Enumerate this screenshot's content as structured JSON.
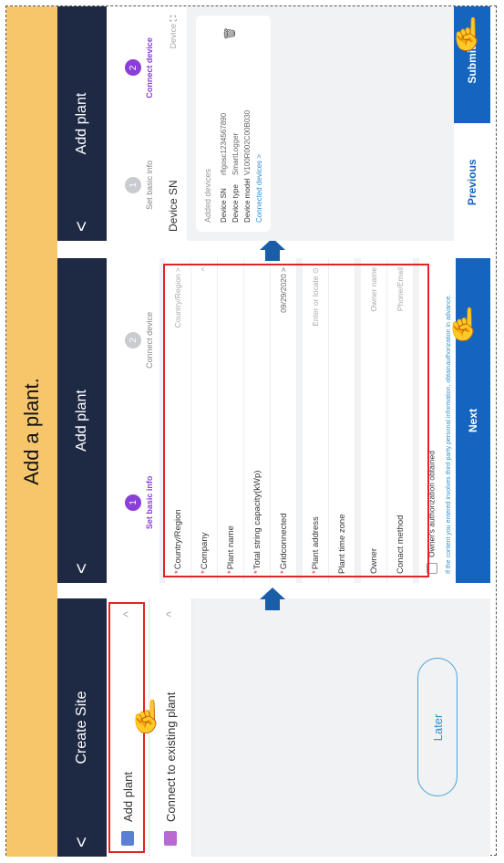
{
  "banner": "Add a plant.",
  "screen1": {
    "title": "Create Site",
    "back": "<",
    "items": [
      {
        "label": "Add plant",
        "chevron": "^"
      },
      {
        "label": "Connect to existing plant",
        "chevron": "^"
      }
    ],
    "later": "Later"
  },
  "screen2": {
    "title": "Add plant",
    "back": "<",
    "steps": [
      {
        "num": "1",
        "label": "Set basic info"
      },
      {
        "num": "2",
        "label": "Connect device"
      }
    ],
    "fields": [
      {
        "label": "Country/Region",
        "required": "*",
        "value": "Country/Region >"
      },
      {
        "label": "Company",
        "required": "*",
        "value": "^"
      },
      {
        "label": "Plant name",
        "required": "*",
        "value": ""
      },
      {
        "label": "Total string capacity(kWp)",
        "required": "*",
        "value": ""
      },
      {
        "label": "Gridconnected",
        "required": "*",
        "value": "09/29/2020 >"
      },
      {
        "label": "Plant address",
        "required": "*",
        "value": "Enter or locate ⊙"
      },
      {
        "label": "Plant time zone",
        "required": "",
        "value": ""
      },
      {
        "label": "Owner",
        "required": "",
        "value": "Owner name"
      },
      {
        "label": "Conact method",
        "required": "",
        "value": "Phone/Email"
      }
    ],
    "consent": "Owner's authorization obtained",
    "note": "If the content you entered involves third-party personal information, obtainauthorization in advance.",
    "next": "Next"
  },
  "screen3": {
    "title": "Add plant",
    "back": "<",
    "steps": [
      {
        "num": "1",
        "label": "Set basic info"
      },
      {
        "num": "2",
        "label": "Connect device"
      }
    ],
    "device_sn_label": "Device SN",
    "device_sn_placeholder": "Device",
    "card": {
      "caption": "Added devices",
      "rows": [
        {
          "k": "Device SN",
          "v": "rfigosc1234567890"
        },
        {
          "k": "Device type",
          "v": "SmartLogger"
        },
        {
          "k": "Device model",
          "v": "V100R002C00B030"
        }
      ],
      "link": "Connected devices >"
    },
    "previous": "Previous",
    "submit": "Submit"
  },
  "colors": {
    "accent": "#8b3fd9",
    "primary": "#1565c0",
    "header": "#1e2a44",
    "banner": "#f7c66b",
    "highlight": "#e32424"
  }
}
